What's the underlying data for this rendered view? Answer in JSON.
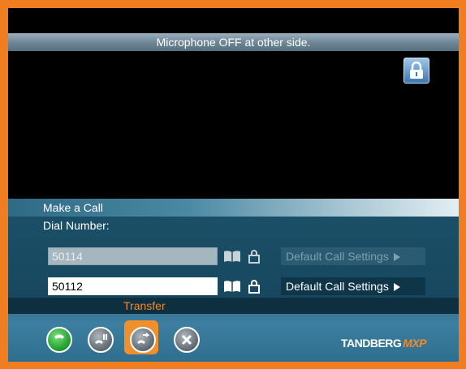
{
  "notification": {
    "text": "Microphone OFF at other side."
  },
  "dial": {
    "section_title": "Make a Call",
    "dial_label": "Dial Number:",
    "rows": [
      {
        "number": "50114",
        "settings_label": "Default Call Settings",
        "active": false
      },
      {
        "number": "50112",
        "settings_label": "Default Call Settings",
        "active": true
      }
    ]
  },
  "actions": {
    "highlight_label": "Transfer",
    "buttons": [
      {
        "name": "call-button",
        "icon": "phone-icon"
      },
      {
        "name": "hold-button",
        "icon": "hold-icon"
      },
      {
        "name": "transfer-button",
        "icon": "transfer-icon",
        "selected": true
      },
      {
        "name": "end-call-button",
        "icon": "close-icon"
      }
    ]
  },
  "brand": {
    "name": "TANDBERG",
    "model": "MXP"
  },
  "colors": {
    "frame": "#f07d1f",
    "panel": "#17485f",
    "accent": "#f28a27"
  }
}
